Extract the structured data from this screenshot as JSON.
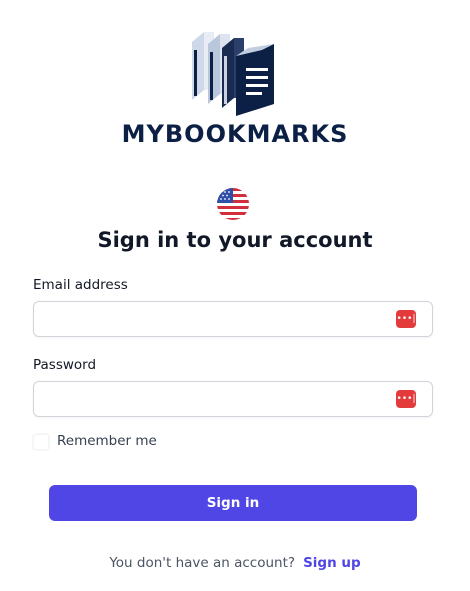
{
  "brand": {
    "name": "MYBOOKMARKS",
    "logo_icon": "bookshelf-logo",
    "color": "#0c1f45"
  },
  "language": {
    "icon": "us-flag-icon"
  },
  "heading": "Sign in to your account",
  "form": {
    "email_label": "Email address",
    "email_value": "",
    "password_label": "Password",
    "password_value": "",
    "password_manager_icon": "password-manager-icon",
    "remember_label": "Remember me",
    "remember_checked": false,
    "submit_label": "Sign in"
  },
  "footer": {
    "prompt": "You don't have an account?",
    "signup_label": "Sign up"
  },
  "colors": {
    "accent": "#4f46e5",
    "password_manager": "#e33b3b"
  }
}
